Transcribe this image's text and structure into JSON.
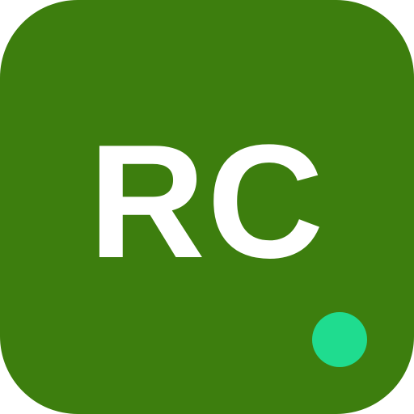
{
  "avatar": {
    "initials": "RC",
    "background_color": "#3d7e0e",
    "text_color": "#ffffff",
    "status_indicator": {
      "icon": "online-status-dot-icon",
      "color": "#1fdc8f"
    }
  }
}
